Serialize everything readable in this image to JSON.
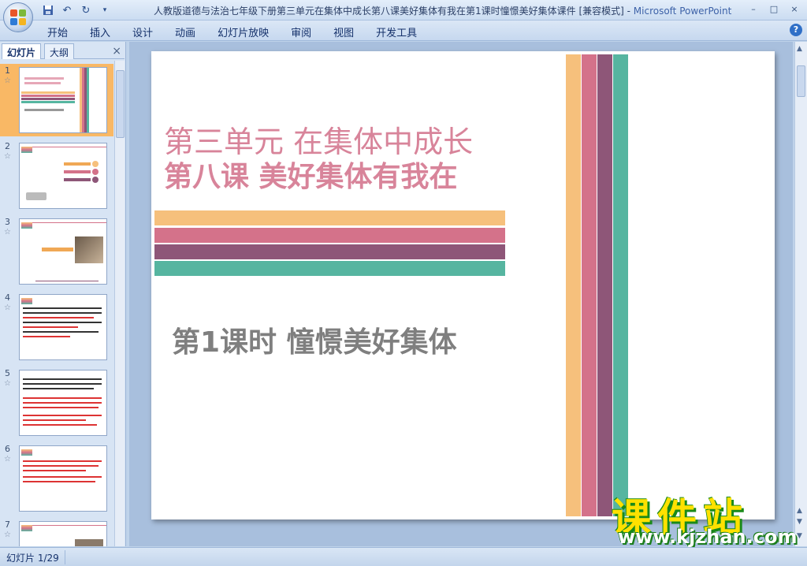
{
  "titlebar": {
    "title": "人教版道德与法治七年级下册第三单元在集体中成长第八课美好集体有我在第1课时憧憬美好集体课件 [兼容模式] - ",
    "app_name": "Microsoft PowerPoint",
    "minimize": "–",
    "restore": "□",
    "close": "×"
  },
  "quick_access": {
    "save_icon": "save-icon",
    "undo_icon": "undo-icon",
    "redo_icon": "redo-icon",
    "customize_icon": "chevron-down-icon"
  },
  "ribbon_tabs": [
    "开始",
    "插入",
    "设计",
    "动画",
    "幻灯片放映",
    "审阅",
    "视图",
    "开发工具"
  ],
  "help": "?",
  "left_pane": {
    "tabs": [
      "幻灯片",
      "大纲"
    ],
    "close": "×",
    "slides": [
      {
        "num": "1",
        "star": "☆"
      },
      {
        "num": "2",
        "star": "☆"
      },
      {
        "num": "3",
        "star": "☆"
      },
      {
        "num": "4",
        "star": "☆"
      },
      {
        "num": "5",
        "star": "☆"
      },
      {
        "num": "6",
        "star": "☆"
      },
      {
        "num": "7",
        "star": "☆"
      }
    ]
  },
  "slide": {
    "line1": "第三单元   在集体中成长",
    "line2": "第八课   美好集体有我在",
    "line3": "第1课时     憧憬美好集体",
    "colors": {
      "orange": "#f6c07c",
      "pink": "#d4728a",
      "purple": "#8e5678",
      "teal": "#56b5a0",
      "title_pink": "#d8849a",
      "gray": "#7f7f7f"
    }
  },
  "watermark": {
    "title": "课件站",
    "url": "www.kjzhan.com"
  },
  "status": {
    "slide_info": "幻灯片 1/29"
  }
}
